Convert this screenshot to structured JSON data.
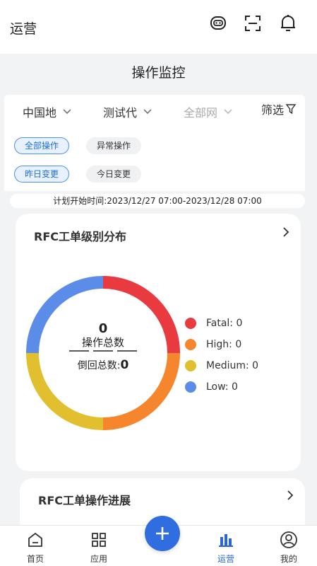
{
  "header": {
    "title": "运营"
  },
  "screen_title": "操作监控",
  "filters": {
    "region": "中国地",
    "test": "测试代",
    "network": "全部网",
    "filter_label": "筛选"
  },
  "chips": {
    "all_ops": "全部操作",
    "abnormal_ops": "异常操作",
    "yesterday_changes": "昨日变更",
    "today_changes": "今日变更"
  },
  "plan_time": "计划开始时间:2023/12/27 07:00-2023/12/28 07:00",
  "rfc_level": {
    "title": "RFC工单级别分布",
    "total_value": "0",
    "total_label": "操作总数",
    "rollback_label": "倒回总数:",
    "rollback_value": "0",
    "legend": [
      {
        "name": "Fatal: 0",
        "color": "#e83a3f"
      },
      {
        "name": "High: 0",
        "color": "#f5862d"
      },
      {
        "name": "Medium: 0",
        "color": "#e2bf2e"
      },
      {
        "name": "Low: 0",
        "color": "#5b8de8"
      }
    ]
  },
  "rfc_progress": {
    "title": "RFC工单操作进展"
  },
  "tabs": {
    "home": "首页",
    "apps": "应用",
    "ops": "运营",
    "mine": "我的"
  },
  "colors": {
    "accent": "#2f6de0",
    "fatal": "#e83a3f",
    "high": "#f5862d",
    "medium": "#e2bf2e",
    "low": "#5b8de8"
  }
}
